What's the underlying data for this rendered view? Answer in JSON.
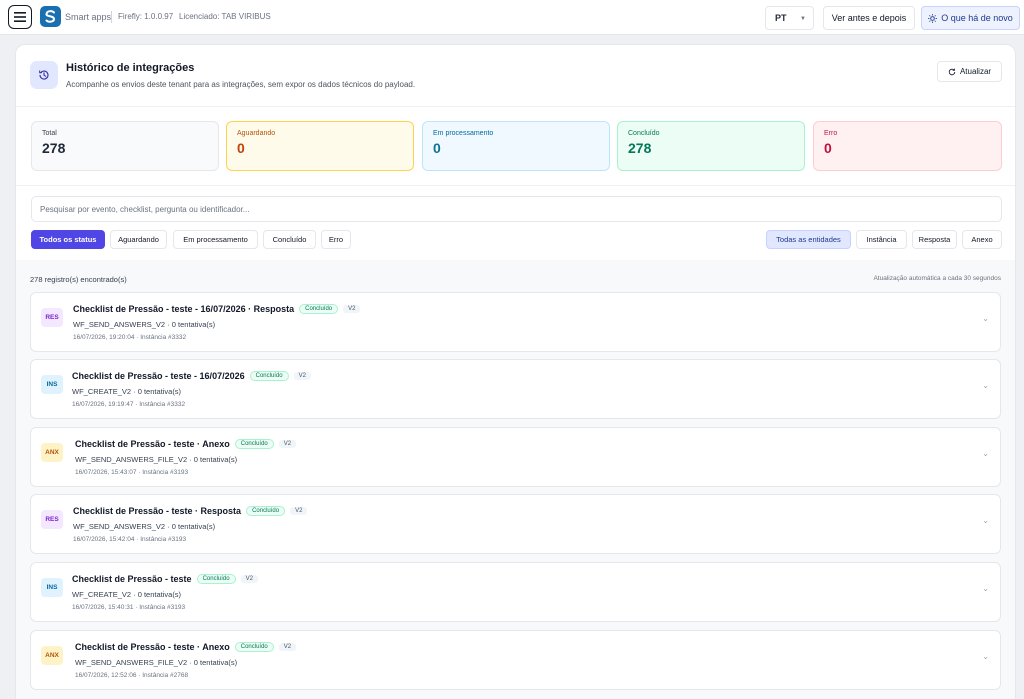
{
  "topbar": {
    "brand": "Smart apps",
    "version": "Firefly: 1.0.0.97",
    "license": "Licenciado: TAB VIRIBUS",
    "language": "PT",
    "compare_label": "Ver antes e depois",
    "news_label": "O que há de novo"
  },
  "header": {
    "title": "Histórico de integrações",
    "subtitle": "Acompanhe os envios deste tenant para as integrações, sem expor os dados técnicos do payload.",
    "refresh_label": "Atualizar"
  },
  "stats": {
    "total": {
      "label": "Total",
      "value": "278"
    },
    "waiting": {
      "label": "Aguardando",
      "value": "0"
    },
    "processing": {
      "label": "Em processamento",
      "value": "0"
    },
    "done": {
      "label": "Concluído",
      "value": "278"
    },
    "error": {
      "label": "Erro",
      "value": "0"
    }
  },
  "search": {
    "placeholder": "Pesquisar por evento, checklist, pergunta ou identificador..."
  },
  "status_filters": [
    "Todos os status",
    "Aguardando",
    "Em processamento",
    "Concluído",
    "Erro"
  ],
  "entity_filters": [
    "Todas as entidades",
    "Instância",
    "Resposta",
    "Anexo"
  ],
  "list": {
    "count": "278 registro(s) encontrado(s)",
    "auto_refresh": "Atualização automática a cada 30 segundos",
    "items": [
      {
        "tag": "RES",
        "title": "Checklist de Pressão - teste - 16/07/2026 · Resposta",
        "status": "Concluído",
        "version": "V2",
        "code": "WF_SEND_ANSWERS_V2 · 0 tentativa(s)",
        "meta": "16/07/2026, 19:20:04 · Instância #3332"
      },
      {
        "tag": "INS",
        "title": "Checklist de Pressão - teste - 16/07/2026",
        "status": "Concluído",
        "version": "V2",
        "code": "WF_CREATE_V2 · 0 tentativa(s)",
        "meta": "16/07/2026, 19:19:47 · Instância #3332"
      },
      {
        "tag": "ANX",
        "title": "Checklist de Pressão - teste · Anexo",
        "status": "Concluído",
        "version": "V2",
        "code": "WF_SEND_ANSWERS_FILE_V2 · 0 tentativa(s)",
        "meta": "16/07/2026, 15:43:07 · Instância #3193"
      },
      {
        "tag": "RES",
        "title": "Checklist de Pressão - teste · Resposta",
        "status": "Concluído",
        "version": "V2",
        "code": "WF_SEND_ANSWERS_V2 · 0 tentativa(s)",
        "meta": "16/07/2026, 15:42:04 · Instância #3193"
      },
      {
        "tag": "INS",
        "title": "Checklist de Pressão - teste",
        "status": "Concluído",
        "version": "V2",
        "code": "WF_CREATE_V2 · 0 tentativa(s)",
        "meta": "16/07/2026, 15:40:31 · Instância #3193"
      },
      {
        "tag": "ANX",
        "title": "Checklist de Pressão - teste · Anexo",
        "status": "Concluído",
        "version": "V2",
        "code": "WF_SEND_ANSWERS_FILE_V2 · 0 tentativa(s)",
        "meta": "16/07/2026, 12:52:06 · Instância #2768"
      }
    ]
  },
  "colors": {
    "accent": "#4f46e5",
    "success": "#047857",
    "warning": "#c2410c",
    "danger": "#be123c"
  }
}
